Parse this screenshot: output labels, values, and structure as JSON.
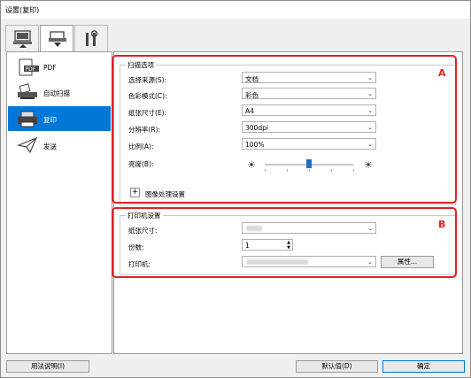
{
  "window": {
    "title": "设置(复印)"
  },
  "tabs": [
    {
      "name": "scan-from-computer"
    },
    {
      "name": "scan-from-panel"
    },
    {
      "name": "general-settings"
    }
  ],
  "sidebar": {
    "items": [
      {
        "label": "PDF"
      },
      {
        "label": "自动扫描"
      },
      {
        "label": "复印"
      },
      {
        "label": "发送"
      }
    ]
  },
  "scan_options": {
    "title": "扫描选项",
    "source": {
      "label": "选择来源(S):",
      "value": "文档"
    },
    "color_mode": {
      "label": "色彩模式(C):",
      "value": "彩色"
    },
    "paper_size": {
      "label": "纸张尺寸(E):",
      "value": "A4"
    },
    "resolution": {
      "label": "分辨率(R):",
      "value": "300dpi"
    },
    "scale": {
      "label": "比例(A):",
      "value": "100%"
    },
    "brightness": {
      "label": "亮度(B):",
      "level": 0.5
    },
    "image_processing": {
      "label": "图像处理设置",
      "expander": "+"
    }
  },
  "printer_settings": {
    "title": "打印机设置",
    "paper_size": {
      "label": "纸张尺寸:"
    },
    "copies": {
      "label": "份数:",
      "value": "1"
    },
    "printer": {
      "label": "打印机:",
      "properties_label": "属性..."
    }
  },
  "annotations": {
    "a": "A",
    "b": "B"
  },
  "footer": {
    "help": "用法说明(I)",
    "defaults": "默认值(D)",
    "ok": "确定"
  },
  "colors": {
    "accent": "#0078d7",
    "highlight": "#e02020"
  }
}
